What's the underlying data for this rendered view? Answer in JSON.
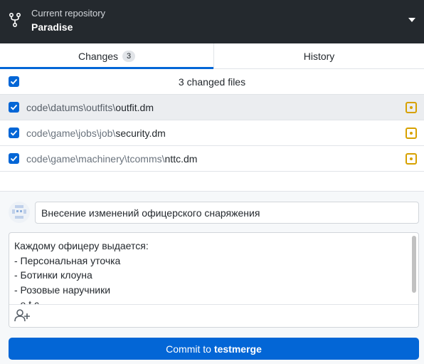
{
  "repository": {
    "caption": "Current repository",
    "name": "Paradise"
  },
  "tabs": {
    "changes": {
      "label": "Changes",
      "count": "3"
    },
    "history": {
      "label": "History"
    }
  },
  "changes": {
    "summary": "3 changed files",
    "files": [
      {
        "dir": "code\\datums\\outfits\\",
        "name": "outfit.dm",
        "checked": true,
        "selected": true,
        "status": "modified"
      },
      {
        "dir": "code\\game\\jobs\\job\\",
        "name": "security.dm",
        "checked": true,
        "selected": false,
        "status": "modified"
      },
      {
        "dir": "code\\game\\machinery\\tcomms\\",
        "name": "nttc.dm",
        "checked": true,
        "selected": false,
        "status": "modified"
      }
    ]
  },
  "commit": {
    "summary_value": "Внесение изменений офицерского снаряжения",
    "description_lines": [
      "Каждому офицеру выдается:",
      "- Персональная уточка",
      "- Ботинки клоуна",
      "- Розовые наручники",
      "- e.t.c"
    ],
    "button_prefix": "Commit to",
    "branch": "testmerge"
  },
  "icons": {
    "repo": "repo-fork-icon",
    "caret": "caret-down-icon",
    "modified": "file-modified-icon",
    "coauthor": "person-add-icon",
    "avatar": "user-avatar-icon"
  },
  "colors": {
    "topbar": "#24292e",
    "accent": "#0366d6",
    "modified": "#d7a100"
  }
}
